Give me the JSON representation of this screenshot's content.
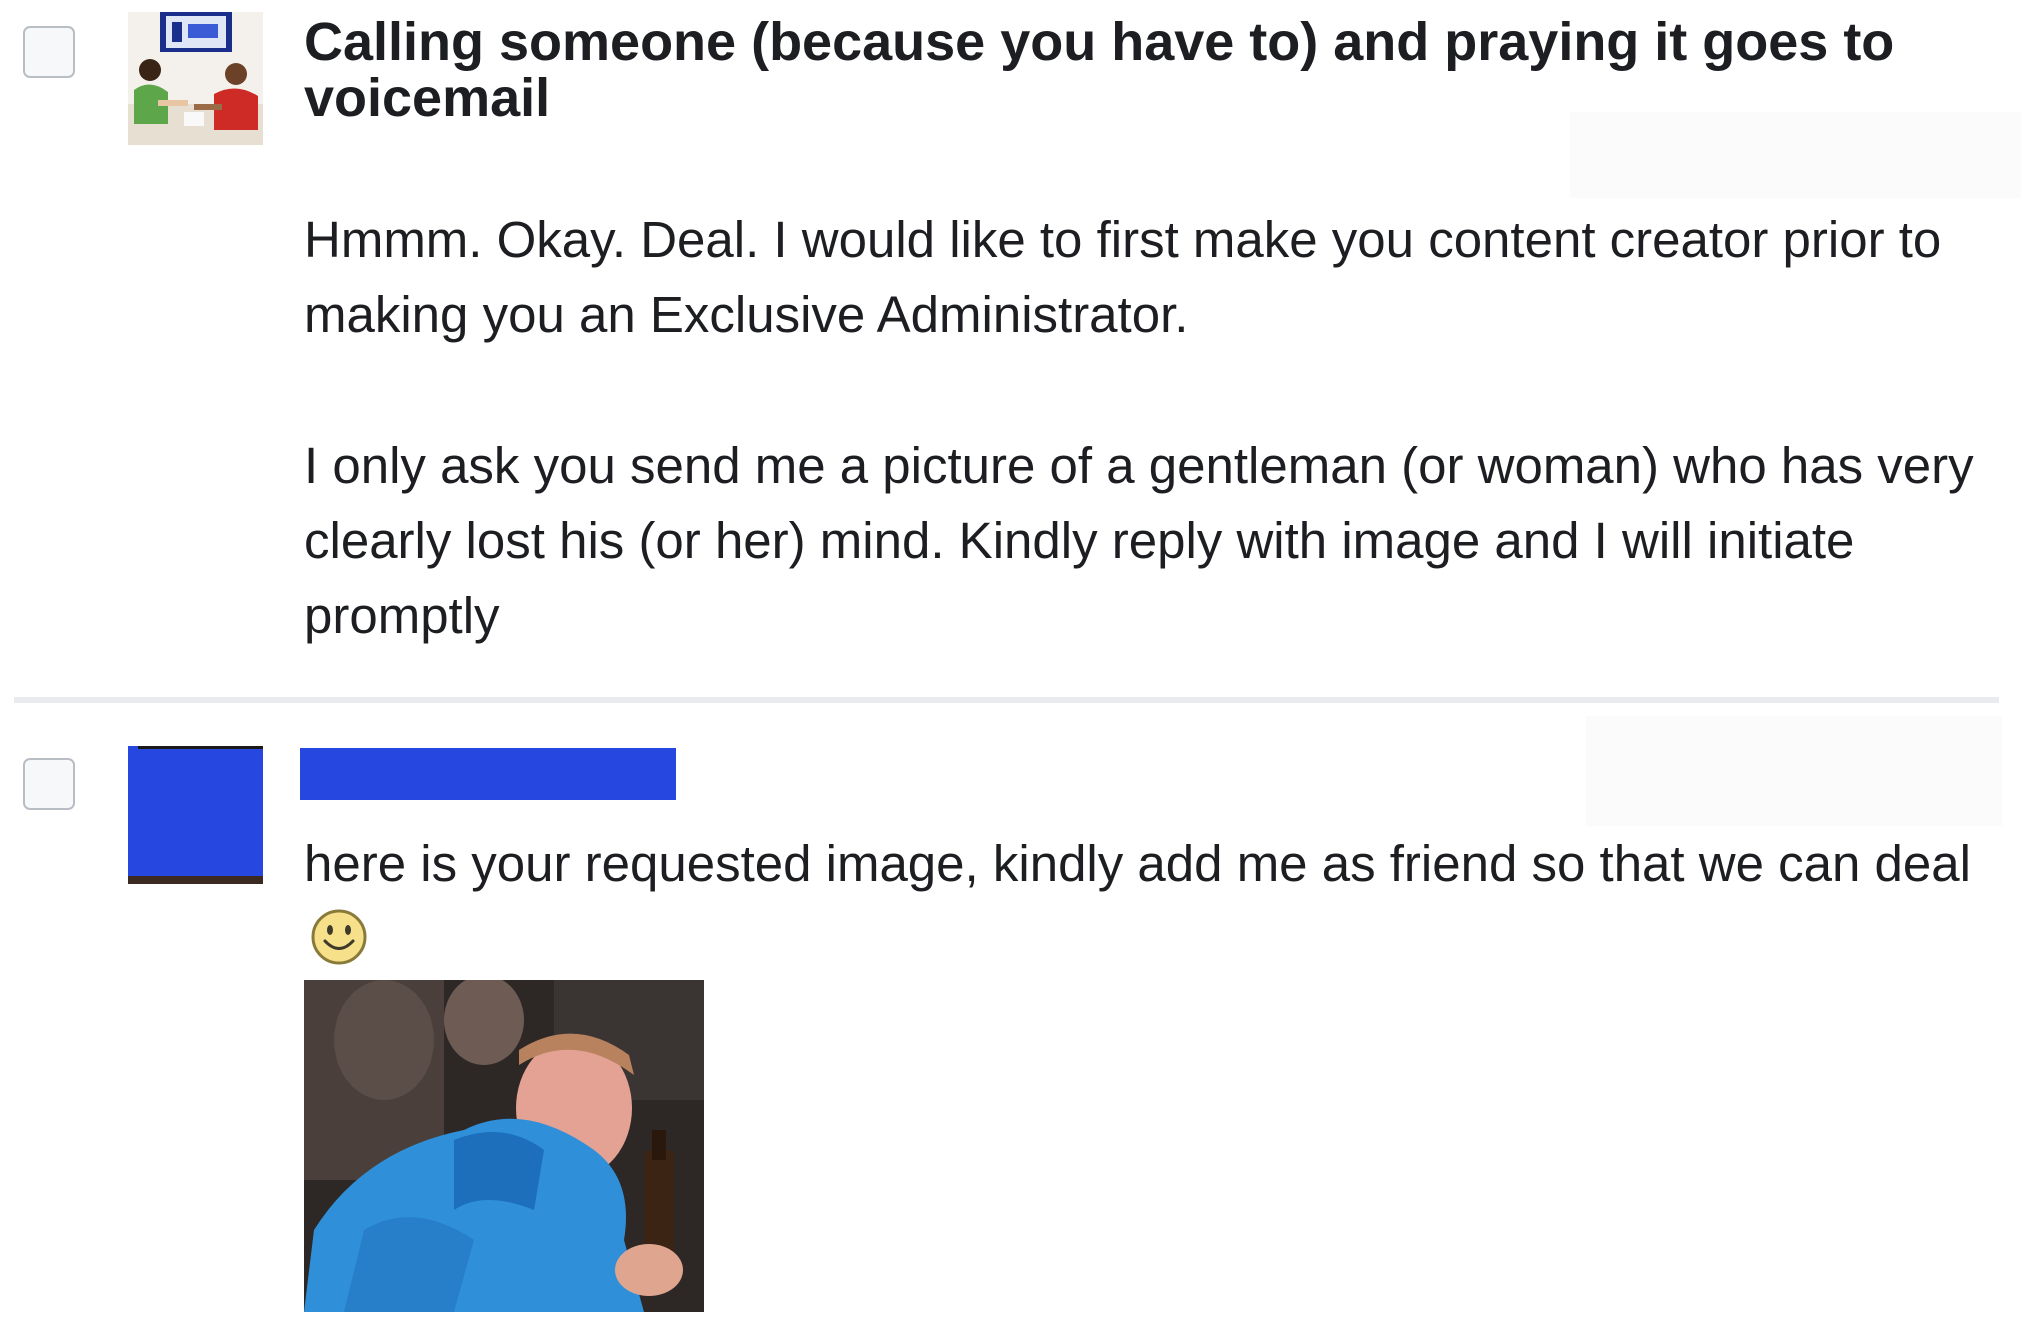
{
  "thread": {
    "messages": [
      {
        "title": "Calling someone (because you have to) and praying it goes to voicemail",
        "paragraphs": [
          "Hmmm. Okay. Deal. I would like to first make you content creator prior to making you an Exclusive Administrator.",
          "I only ask you send me a picture of a gentleman (or woman) who has very clearly lost his (or her) mind. Kindly reply with image and I will initiate promptly"
        ],
        "avatar_icon": "voicemail-photo-avatar"
      },
      {
        "text": "here is your requested image, kindly add me as friend so that we can deal",
        "emoji_icon": "smiley-icon",
        "avatar_icon": "redacted-avatar",
        "attachment_icon": "attached-photo"
      }
    ]
  },
  "colors": {
    "redaction": "#2647e0",
    "divider": "#e9ebee",
    "text": "#1c1e21"
  }
}
